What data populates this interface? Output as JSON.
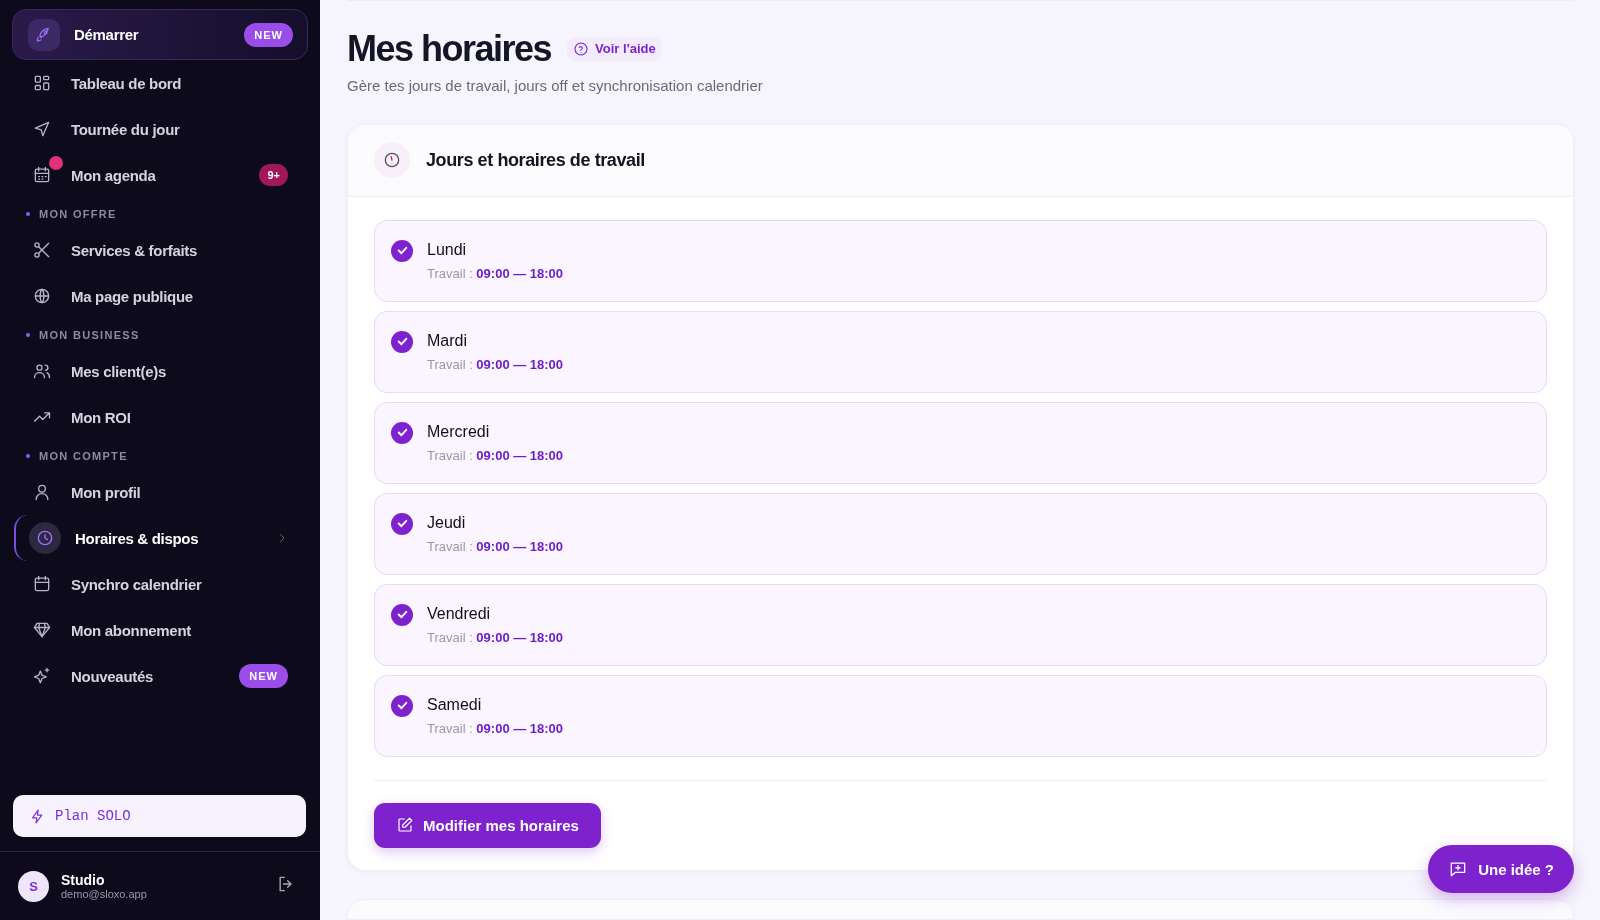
{
  "sidebar": {
    "items": [
      {
        "kind": "featured",
        "label": "Démarrer",
        "selected": false,
        "alert": false,
        "badge": {
          "text": "NEW",
          "kind": "new"
        }
      },
      {
        "kind": "item",
        "label": "Tableau de bord",
        "selected": false,
        "alert": false
      },
      {
        "kind": "item",
        "label": "Tournée du jour",
        "selected": false,
        "alert": false
      },
      {
        "kind": "item",
        "label": "Mon agenda",
        "selected": false,
        "alert": true,
        "badge": {
          "text": "9+",
          "kind": "count"
        }
      },
      {
        "kind": "section",
        "label": "MON OFFRE"
      },
      {
        "kind": "item",
        "label": "Services & forfaits",
        "selected": false,
        "alert": false
      },
      {
        "kind": "item",
        "label": "Ma page publique",
        "selected": false,
        "alert": false
      },
      {
        "kind": "section",
        "label": "MON BUSINESS"
      },
      {
        "kind": "item",
        "label": "Mes client(e)s",
        "selected": false,
        "alert": false
      },
      {
        "kind": "item",
        "label": "Mon ROI",
        "selected": false,
        "alert": false
      },
      {
        "kind": "section",
        "label": "MON COMPTE"
      },
      {
        "kind": "item",
        "label": "Mon profil",
        "selected": false,
        "alert": false
      },
      {
        "kind": "item",
        "label": "Horaires & dispos",
        "selected": true,
        "alert": false
      },
      {
        "kind": "item",
        "label": "Synchro calendrier",
        "selected": false,
        "alert": false
      },
      {
        "kind": "item",
        "label": "Mon abonnement",
        "selected": false,
        "alert": false
      },
      {
        "kind": "item",
        "label": "Nouveautés",
        "selected": false,
        "alert": false,
        "badge": {
          "text": "NEW",
          "kind": "new"
        }
      }
    ],
    "plan": {
      "label": "Plan SOLO"
    },
    "user": {
      "initial": "S",
      "name": "Studio",
      "email": "demo@sloxo.app"
    }
  },
  "header": {
    "title": "Mes horaires",
    "help_link": "Voir l'aide",
    "subtitle": "Gère tes jours de travail, jours off et synchronisation calendrier"
  },
  "work_card": {
    "title": "Jours et horaires de travail",
    "days": [
      {
        "name": "Lundi",
        "checked": true,
        "label": "Travail :",
        "hours": "09:00 — 18:00"
      },
      {
        "name": "Mardi",
        "checked": true,
        "label": "Travail :",
        "hours": "09:00 — 18:00"
      },
      {
        "name": "Mercredi",
        "checked": true,
        "label": "Travail :",
        "hours": "09:00 — 18:00"
      },
      {
        "name": "Jeudi",
        "checked": true,
        "label": "Travail :",
        "hours": "09:00 — 18:00"
      },
      {
        "name": "Vendredi",
        "checked": true,
        "label": "Travail :",
        "hours": "09:00 — 18:00"
      },
      {
        "name": "Samedi",
        "checked": true,
        "label": "Travail :",
        "hours": "09:00 — 18:00"
      }
    ],
    "button": "Modifier mes horaires"
  },
  "feedback_button": "Une idée ?"
}
